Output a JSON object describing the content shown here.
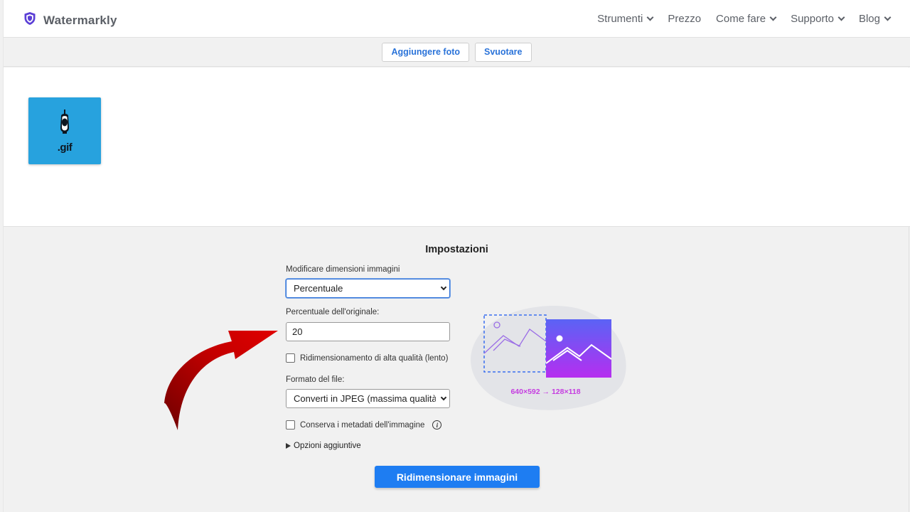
{
  "header": {
    "brand": "Watermarkly",
    "nav": [
      {
        "label": "Strumenti",
        "dropdown": true
      },
      {
        "label": "Prezzo",
        "dropdown": false
      },
      {
        "label": "Come fare",
        "dropdown": true
      },
      {
        "label": "Supporto",
        "dropdown": true
      },
      {
        "label": "Blog",
        "dropdown": true
      }
    ]
  },
  "toolbar": {
    "add_label": "Aggiungere foto",
    "clear_label": "Svuotare"
  },
  "images": [
    {
      "label": ".gif"
    }
  ],
  "settings": {
    "title": "Impostazioni",
    "resize_mode_label": "Modificare dimensioni immagini",
    "resize_mode_value": "Percentuale",
    "percent_label": "Percentuale dell'originale:",
    "percent_value": "20",
    "high_quality_label": "Ridimensionamento di alta qualità (lento)",
    "high_quality_checked": false,
    "format_label": "Formato del file:",
    "format_value": "Converti in JPEG (massima qualità, f",
    "keep_metadata_label": "Conserva i metadati dell'immagine",
    "keep_metadata_checked": false,
    "more_options_label": "Opzioni aggiuntive",
    "submit_label": "Ridimensionare immagini",
    "preview_dims": "640×592 → 128×118"
  },
  "colors": {
    "accent": "#1e7df2",
    "link": "#2a73d9",
    "thumb_bg": "#27a2de",
    "dims_text": "#c53de0",
    "annotation_arrow": "#b30000"
  }
}
